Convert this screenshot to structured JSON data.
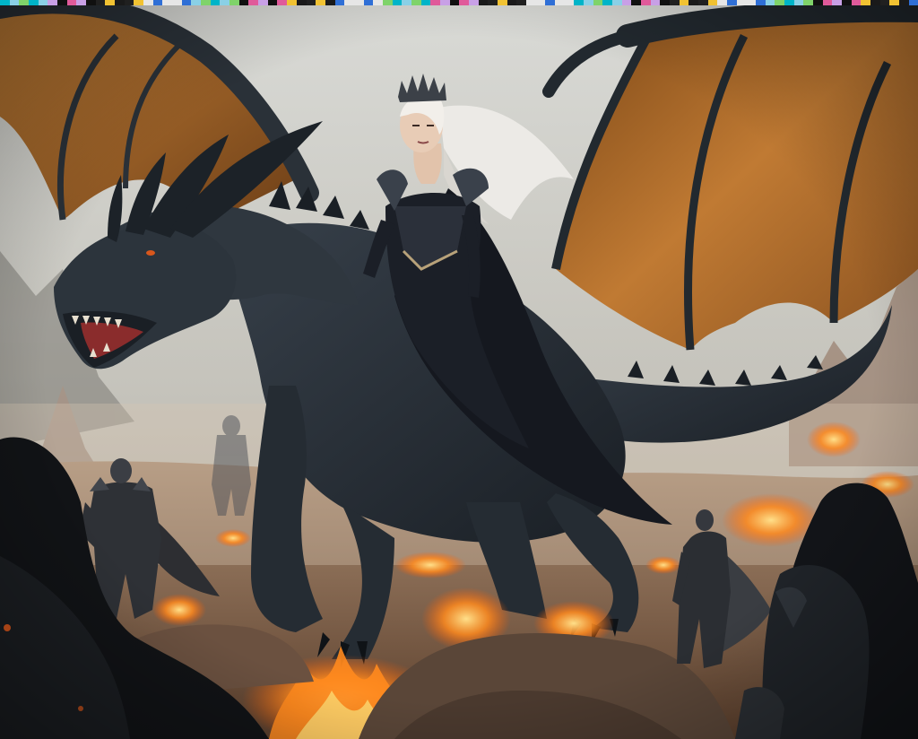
{
  "image": {
    "subject": "dragon-rider",
    "colors": {
      "sky_top": "#d9dad6",
      "sky_bottom": "#b9bcb6",
      "haze": "#cbb6a0",
      "dragon_body": "#2a3138",
      "dragon_shade": "#171c21",
      "wing_membrane": "#b9742d",
      "wing_membrane_dark": "#6e3f17",
      "fire": "#ff8a1e",
      "fire_core": "#ffd36a",
      "ground": "#7a5a44",
      "rock": "#5a4638",
      "rider_dress": "#1b1f27",
      "rider_hair": "#eceae6",
      "eye": "#d8571c"
    },
    "glitch_colors": [
      "#00b4c8",
      "#e6e6e6",
      "#1a1a1a",
      "#e05a9a",
      "#7fd36a",
      "#2f6fd6",
      "#f1c232",
      "#101010",
      "#8ad0e6",
      "#e6e6e6",
      "#202020",
      "#c8a0e6"
    ]
  }
}
